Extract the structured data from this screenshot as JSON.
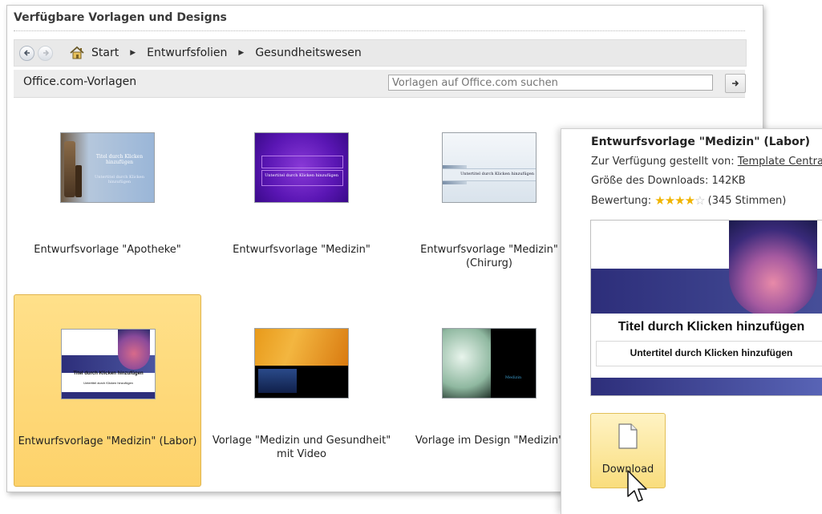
{
  "gallery": {
    "heading": "Verfügbare Vorlagen und Designs",
    "nav": {
      "back_icon": "arrow-left-icon",
      "forward_icon": "arrow-right-icon",
      "home_icon": "home-icon",
      "breadcrumb": [
        "Start",
        "Entwurfsfolien",
        "Gesundheitswesen"
      ]
    },
    "source_label": "Office.com-Vorlagen",
    "search_placeholder": "Vorlagen auf Office.com suchen",
    "search_go_icon": "arrow-right-icon",
    "templates": [
      {
        "label": "Entwurfsvorlage \"Apotheke\"",
        "thumb_title": "Titel durch Klicken hinzufügen",
        "thumb_sub": "Untertitel durch Klicken hinzufügen"
      },
      {
        "label": "Entwurfsvorlage \"Medizin\"",
        "thumb_title": "Untertitel durch Klicken hinzufügen"
      },
      {
        "label_line1": "Entwurfsvorlage \"Medizin\"",
        "label_line2": "(Chirurg)",
        "thumb_title": "Untertitel durch Klicken hinzufügen"
      },
      {
        "label": "Entwurfsvorlage \"Medizin\" (Labor)",
        "selected": true,
        "thumb_title": "Titel durch Klicken hinzufügen",
        "thumb_sub": "Untertitel durch Klicken hinzufügen"
      },
      {
        "label_line1": "Vorlage \"Medizin und Gesundheit\"",
        "label_line2": "mit Video"
      },
      {
        "label": "Vorlage im Design \"Medizin\"",
        "thumb_title": "Medizin"
      }
    ]
  },
  "details": {
    "title": "Entwurfsvorlage \"Medizin\" (Labor)",
    "provided_by_label": "Zur Verfügung gestellt von:",
    "provided_by_link": "Template Central",
    "size_text": "Größe des Downloads: 142KB",
    "rating_label": "Bewertung:",
    "rating_stars": 4,
    "rating_max": 5,
    "votes_text": "(345 Stimmen)",
    "preview_title": "Titel durch Klicken hinzufügen",
    "preview_subtitle": "Untertitel durch Klicken hinzufügen",
    "download_label": "Download",
    "download_icon": "document-icon"
  },
  "colors": {
    "selected_tile": "#fdd26a",
    "download_button": "#f9dd7d",
    "star": "#f0b400"
  }
}
